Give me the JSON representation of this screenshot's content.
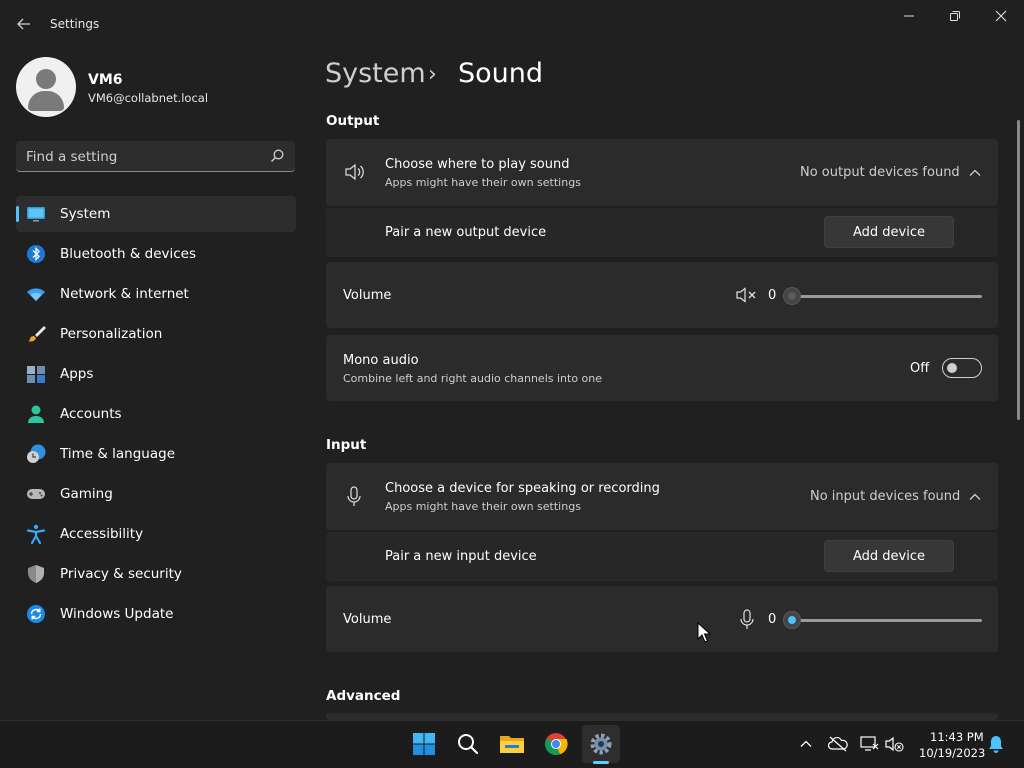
{
  "window": {
    "title": "Settings"
  },
  "user": {
    "name": "VM6",
    "email": "VM6@collabnet.local"
  },
  "search": {
    "placeholder": "Find a setting"
  },
  "nav": [
    {
      "label": "System",
      "icon": "system-icon",
      "selected": true
    },
    {
      "label": "Bluetooth & devices",
      "icon": "bluetooth-icon"
    },
    {
      "label": "Network & internet",
      "icon": "wifi-icon"
    },
    {
      "label": "Personalization",
      "icon": "brush-icon"
    },
    {
      "label": "Apps",
      "icon": "apps-icon"
    },
    {
      "label": "Accounts",
      "icon": "account-icon"
    },
    {
      "label": "Time & language",
      "icon": "clock-globe-icon"
    },
    {
      "label": "Gaming",
      "icon": "gamepad-icon"
    },
    {
      "label": "Accessibility",
      "icon": "accessibility-icon"
    },
    {
      "label": "Privacy & security",
      "icon": "shield-icon"
    },
    {
      "label": "Windows Update",
      "icon": "update-icon"
    }
  ],
  "breadcrumb": {
    "root": "System",
    "separator": "›",
    "current": "Sound"
  },
  "output": {
    "title": "Output",
    "device_card": {
      "title": "Choose where to play sound",
      "desc": "Apps might have their own settings",
      "status": "No output devices found"
    },
    "pair": {
      "label": "Pair a new output device",
      "button": "Add device"
    },
    "volume": {
      "label": "Volume",
      "value": "0",
      "level": 0
    },
    "mono": {
      "title": "Mono audio",
      "desc": "Combine left and right audio channels into one",
      "state": "Off"
    }
  },
  "input": {
    "title": "Input",
    "device_card": {
      "title": "Choose a device for speaking or recording",
      "desc": "Apps might have their own settings",
      "status": "No input devices found"
    },
    "pair": {
      "label": "Pair a new input device",
      "button": "Add device"
    },
    "volume": {
      "label": "Volume",
      "value": "0",
      "level": 0
    }
  },
  "advanced": {
    "title": "Advanced"
  },
  "taskbar": {
    "time": "11:43 PM",
    "date": "10/19/2023"
  },
  "colors": {
    "accent": "#4cc2ff",
    "background": "#202020",
    "card": "#2b2b2b"
  }
}
